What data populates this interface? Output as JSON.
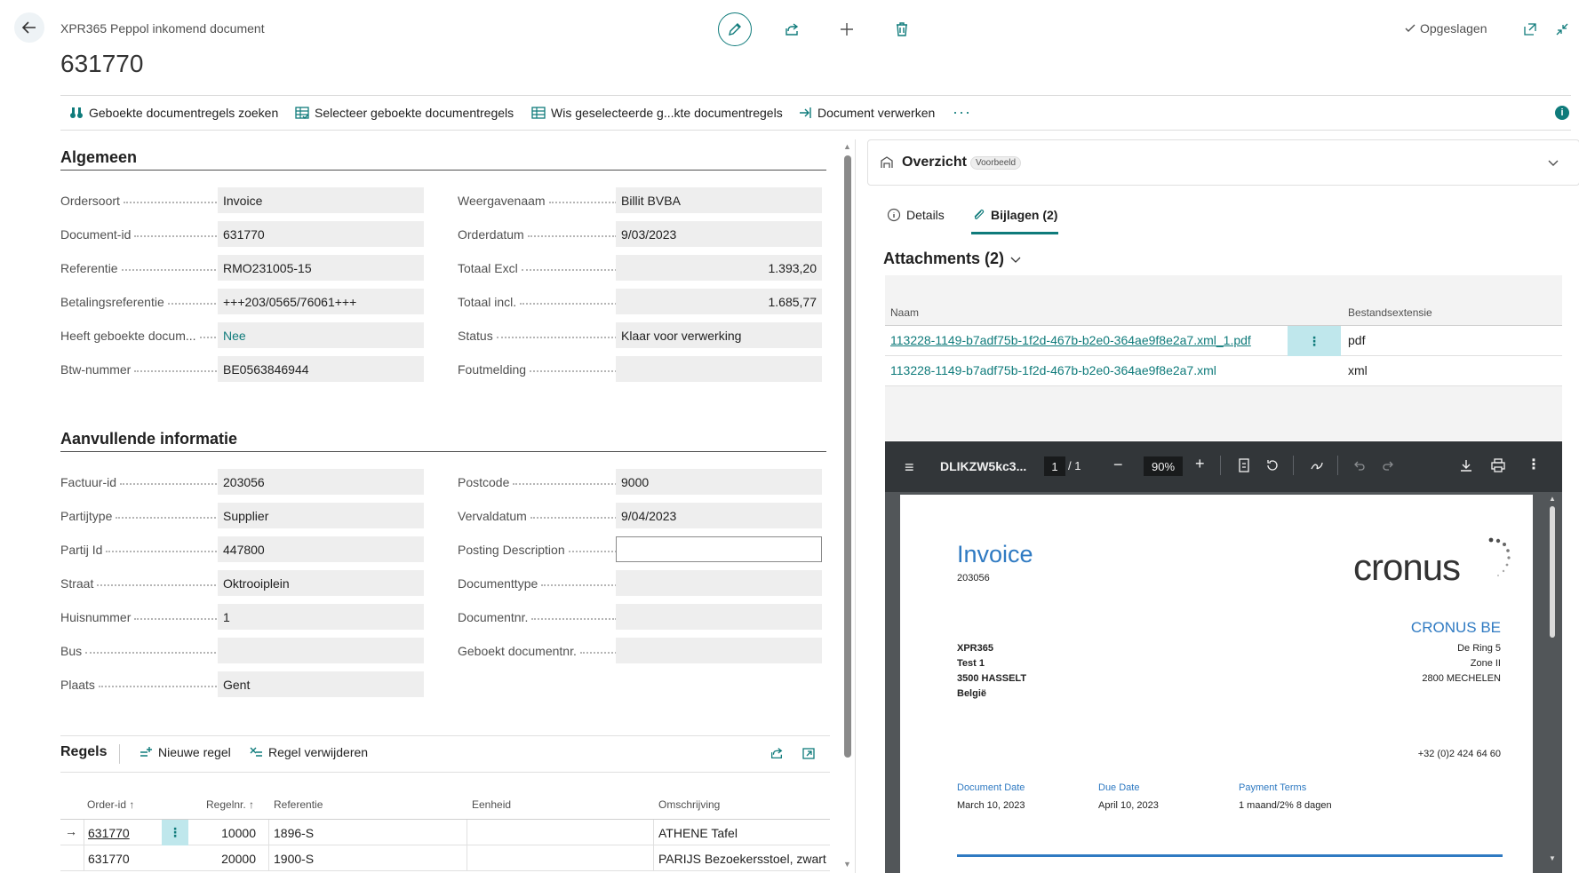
{
  "header": {
    "caption": "XPR365 Peppol inkomend document",
    "title": "631770",
    "saved_label": "Opgeslagen"
  },
  "actions": [
    {
      "label": "Geboekte documentregels zoeken",
      "icon": "binoculars-icon"
    },
    {
      "label": "Selecteer geboekte documentregels",
      "icon": "select-lines-icon"
    },
    {
      "label": "Wis geselecteerde g...kte documentregels",
      "icon": "clear-lines-icon"
    },
    {
      "label": "Document verwerken",
      "icon": "process-icon"
    }
  ],
  "more_label": "···",
  "info_label": "i",
  "algemeen": {
    "title": "Algemeen",
    "left": [
      {
        "label": "Ordersoort",
        "value": "Invoice"
      },
      {
        "label": "Document-id",
        "value": "631770"
      },
      {
        "label": "Referentie",
        "value": "RMO231005-15"
      },
      {
        "label": "Betalingsreferentie",
        "value": "+++203/0565/76061+++"
      },
      {
        "label": "Heeft geboekte docum...",
        "value": "Nee"
      },
      {
        "label": "Btw-nummer",
        "value": "BE0563846944"
      }
    ],
    "right": [
      {
        "label": "Weergavenaam",
        "value": "Billit BVBA"
      },
      {
        "label": "Orderdatum",
        "value": "9/03/2023"
      },
      {
        "label": "Totaal Excl",
        "value": "1.393,20"
      },
      {
        "label": "Totaal incl.",
        "value": "1.685,77"
      },
      {
        "label": "Status",
        "value": "Klaar voor verwerking"
      },
      {
        "label": "Foutmelding",
        "value": ""
      }
    ]
  },
  "aanvullend": {
    "title": "Aanvullende informatie",
    "left": [
      {
        "label": "Factuur-id",
        "value": "203056"
      },
      {
        "label": "Partijtype",
        "value": "Supplier"
      },
      {
        "label": "Partij Id",
        "value": "447800"
      },
      {
        "label": "Straat",
        "value": "Oktrooiplein"
      },
      {
        "label": "Huisnummer",
        "value": "1"
      },
      {
        "label": "Bus",
        "value": ""
      },
      {
        "label": "Plaats",
        "value": "Gent"
      }
    ],
    "right": [
      {
        "label": "Postcode",
        "value": "9000"
      },
      {
        "label": "Vervaldatum",
        "value": "9/04/2023"
      },
      {
        "label": "Posting Description",
        "value": ""
      },
      {
        "label": "Documenttype",
        "value": ""
      },
      {
        "label": "Documentnr.",
        "value": ""
      },
      {
        "label": "Geboekt documentnr.",
        "value": ""
      }
    ]
  },
  "regels": {
    "title": "Regels",
    "new_line": "Nieuwe regel",
    "delete_line": "Regel verwijderen",
    "columns": [
      "Order-id ↑",
      "Regelnr. ↑",
      "Referentie",
      "Eenheid",
      "Omschrijving"
    ],
    "rows": [
      {
        "order_id": "631770",
        "line_no": "10000",
        "ref": "1896-S",
        "unit": "",
        "desc": "ATHENE Tafel"
      },
      {
        "order_id": "631770",
        "line_no": "20000",
        "ref": "1900-S",
        "unit": "",
        "desc": "PARIJS Bezoekersstoel, zwart"
      }
    ]
  },
  "factbox": {
    "title": "Overzicht",
    "badge": "Voorbeeld",
    "tabs": [
      "Details",
      "Bijlagen (2)"
    ],
    "attachments_title": "Attachments (2)",
    "columns": [
      "Naam",
      "Bestandsextensie"
    ],
    "rows": [
      {
        "name": "113228-1149-b7adf75b-1f2d-467b-b2e0-364ae9f8e2a7.xml_1.pdf",
        "ext": "pdf"
      },
      {
        "name": "113228-1149-b7adf75b-1f2d-467b-b2e0-364ae9f8e2a7.xml",
        "ext": "xml"
      }
    ]
  },
  "pdf": {
    "filename": "DLIKZW5kc3...",
    "page": "1",
    "page_total": "/  1",
    "zoom": "90%",
    "invoice_title": "Invoice",
    "invoice_no": "203056",
    "logo": "cronus",
    "company": "CRONUS BE",
    "to_lines": [
      "XPR365",
      "Test 1",
      "3500 HASSELT",
      "België"
    ],
    "from_lines": [
      "De Ring 5",
      "Zone II",
      "2800 MECHELEN"
    ],
    "phone": "+32 (0)2 424 64 60",
    "meta": [
      {
        "label": "Document Date",
        "value": "March 10, 2023"
      },
      {
        "label": "Due Date",
        "value": "April 10, 2023"
      },
      {
        "label": "Payment Terms",
        "value": "1 maand/2% 8 dagen"
      }
    ]
  },
  "colors": {
    "accent": "#0f7b7b",
    "pdf_blue": "#2f7ac2",
    "field_bg": "#eeeeee"
  }
}
